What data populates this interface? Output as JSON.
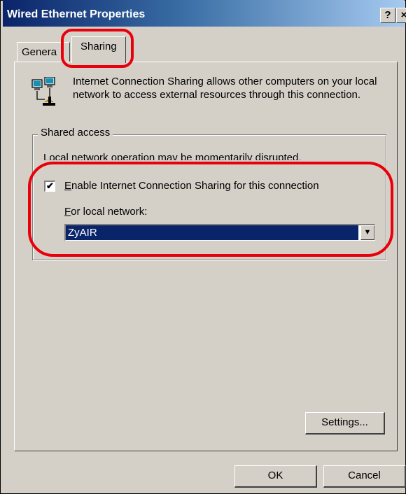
{
  "window": {
    "title": "Wired Ethernet Properties",
    "help_glyph": "?",
    "close_glyph": "×"
  },
  "tabs": [
    {
      "label": "Genera"
    },
    {
      "label": "Sharing"
    }
  ],
  "description": "Internet Connection Sharing allows other computers on your local network to access external resources through this connection.",
  "shared_access": {
    "group_label": "Shared access",
    "warning": "Local network operation may be momentarily disrupted.",
    "enable": {
      "checked": true,
      "check_glyph": "✔",
      "label_accel": "E",
      "label_rest": "nable Internet Connection Sharing for this connection"
    },
    "local_network": {
      "label_accel": "F",
      "label_rest": "or local network:",
      "selected": "ZyAIR",
      "arrow_glyph": "▼"
    }
  },
  "buttons": {
    "settings": "Settings...",
    "ok": "OK",
    "cancel": "Cancel"
  },
  "colors": {
    "highlight_outline": "#e8000b",
    "title_bar": "#0a246a",
    "dialog_face": "#d4d0c8"
  }
}
